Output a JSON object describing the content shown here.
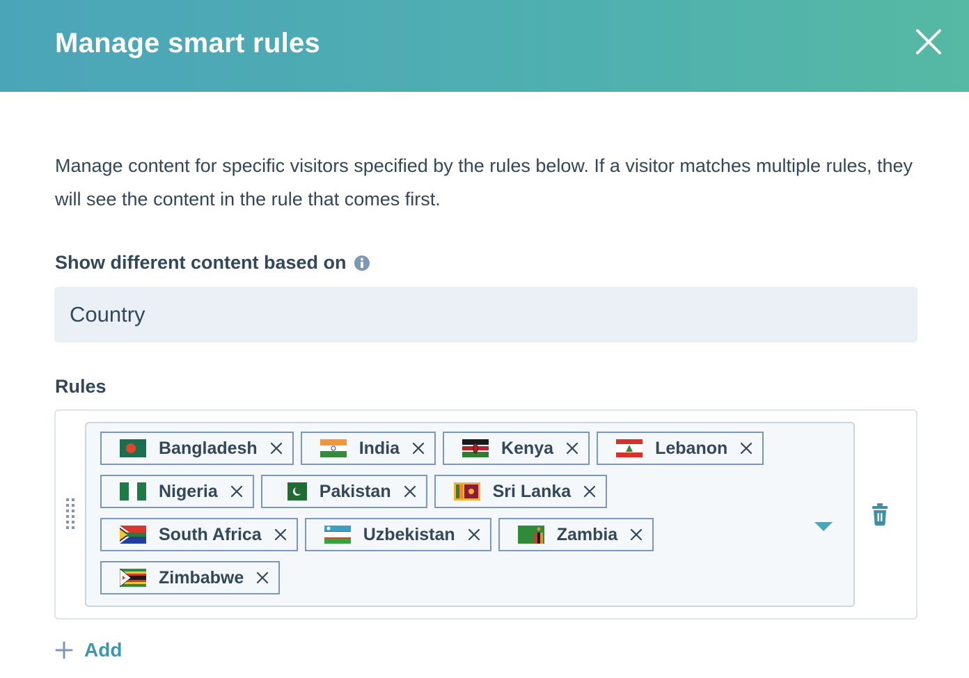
{
  "header": {
    "title": "Manage smart rules",
    "close_icon": "close-icon"
  },
  "description": "Manage content for specific visitors specified by the rules below. If a visitor matches multiple rules, they will see the content in the rule that comes first.",
  "based_on": {
    "label": "Show different content based on",
    "info_icon": "info-icon",
    "selected_value": "Country"
  },
  "rules": {
    "label": "Rules",
    "items": [
      {
        "tags": [
          {
            "label": "Bangladesh",
            "flag": "bd"
          },
          {
            "label": "India",
            "flag": "in"
          },
          {
            "label": "Kenya",
            "flag": "ke"
          },
          {
            "label": "Lebanon",
            "flag": "lb"
          },
          {
            "label": "Nigeria",
            "flag": "ng"
          },
          {
            "label": "Pakistan",
            "flag": "pk"
          },
          {
            "label": "Sri Lanka",
            "flag": "lk"
          },
          {
            "label": "South Africa",
            "flag": "za"
          },
          {
            "label": "Uzbekistan",
            "flag": "uz"
          },
          {
            "label": "Zambia",
            "flag": "zm"
          },
          {
            "label": "Zimbabwe",
            "flag": "zw"
          }
        ]
      }
    ]
  },
  "add_button": {
    "label": "Add",
    "icon": "plus-icon"
  },
  "colors": {
    "header_gradient_start": "#4ba5b8",
    "header_gradient_end": "#55b9a3",
    "text": "#33475b",
    "accent": "#3f96ad",
    "tag_border": "#7c98b6",
    "field_bg": "#eaf0f6"
  }
}
